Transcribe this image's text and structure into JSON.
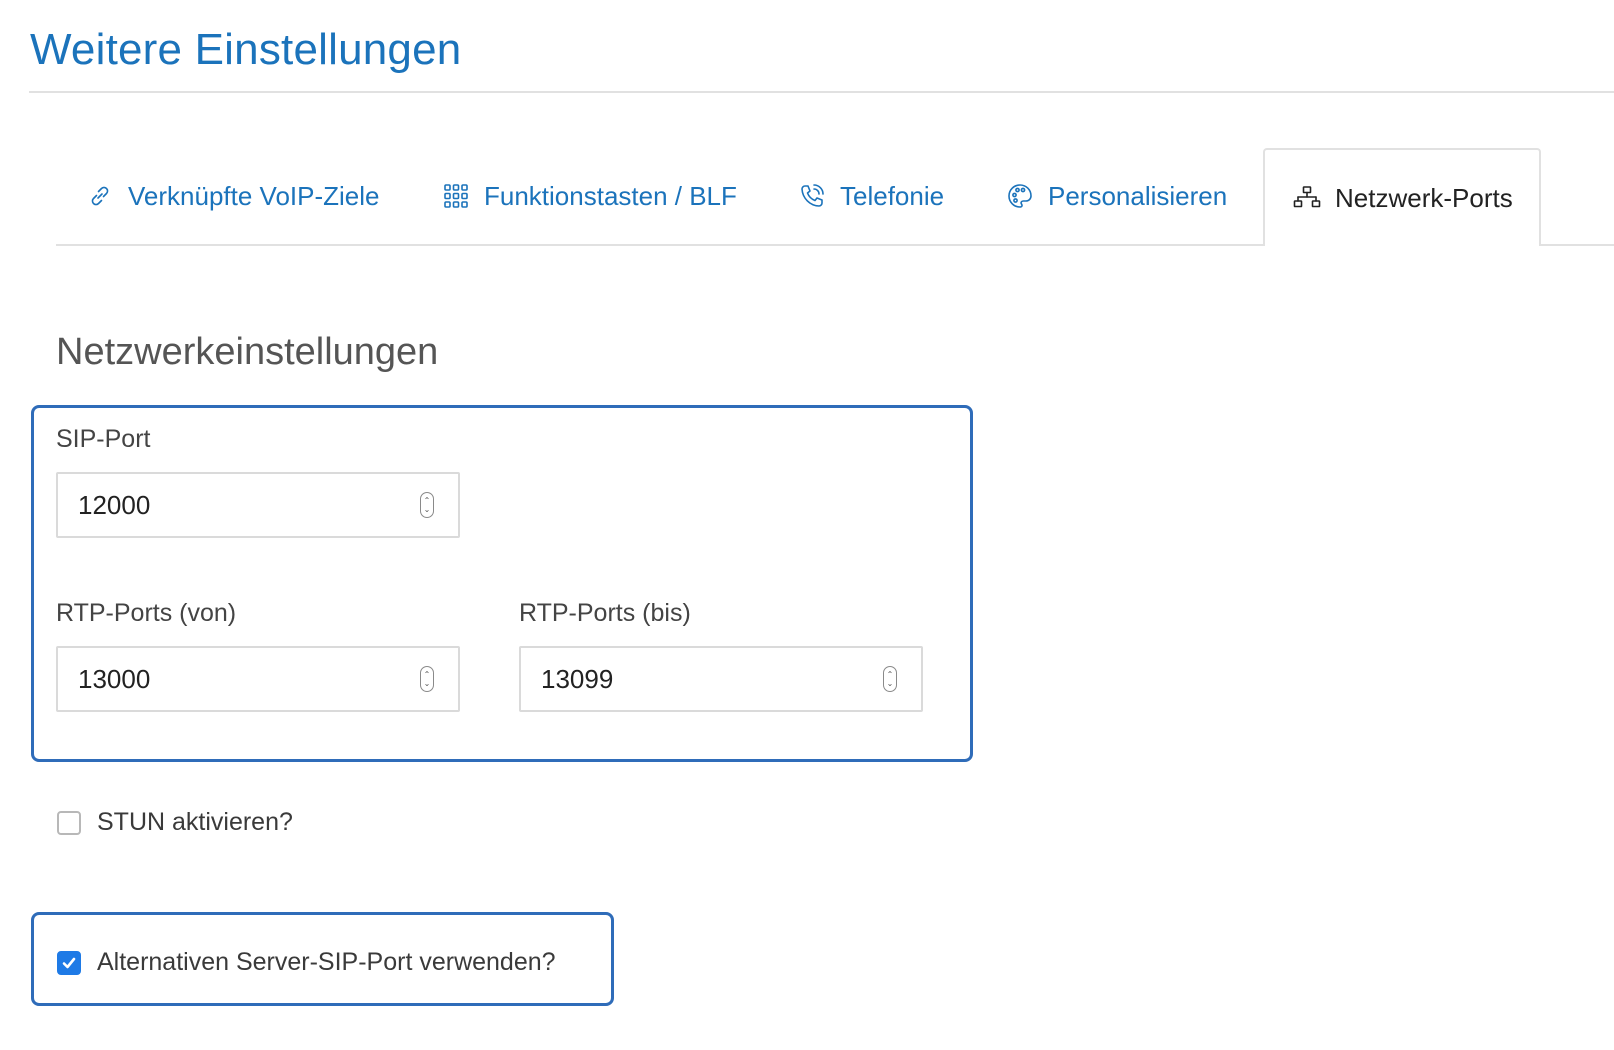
{
  "page": {
    "title": "Weitere Einstellungen"
  },
  "tabs": [
    {
      "label": "Verknüpfte VoIP-Ziele",
      "icon": "link-icon",
      "active": false
    },
    {
      "label": "Funktionstasten / BLF",
      "icon": "keypad-grid-icon",
      "active": false
    },
    {
      "label": "Telefonie",
      "icon": "phone-call-icon",
      "active": false
    },
    {
      "label": "Personalisieren",
      "icon": "palette-icon",
      "active": false
    },
    {
      "label": "Netzwerk-Ports",
      "icon": "network-icon",
      "active": true
    }
  ],
  "section": {
    "title": "Netzwerkeinstellungen"
  },
  "fields": {
    "sip_port": {
      "label": "SIP-Port",
      "value": "12000"
    },
    "rtp_from": {
      "label": "RTP-Ports (von)",
      "value": "13000"
    },
    "rtp_to": {
      "label": "RTP-Ports (bis)",
      "value": "13099"
    }
  },
  "options": {
    "stun": {
      "label": "STUN aktivieren?",
      "checked": false
    },
    "alt_server_sip_port": {
      "label": "Alternativen Server-SIP-Port verwenden?",
      "checked": true
    }
  },
  "colors": {
    "accent": "#1b73bb",
    "highlight_border": "#2f6cb9",
    "checkbox_checked": "#1e7ae6"
  }
}
